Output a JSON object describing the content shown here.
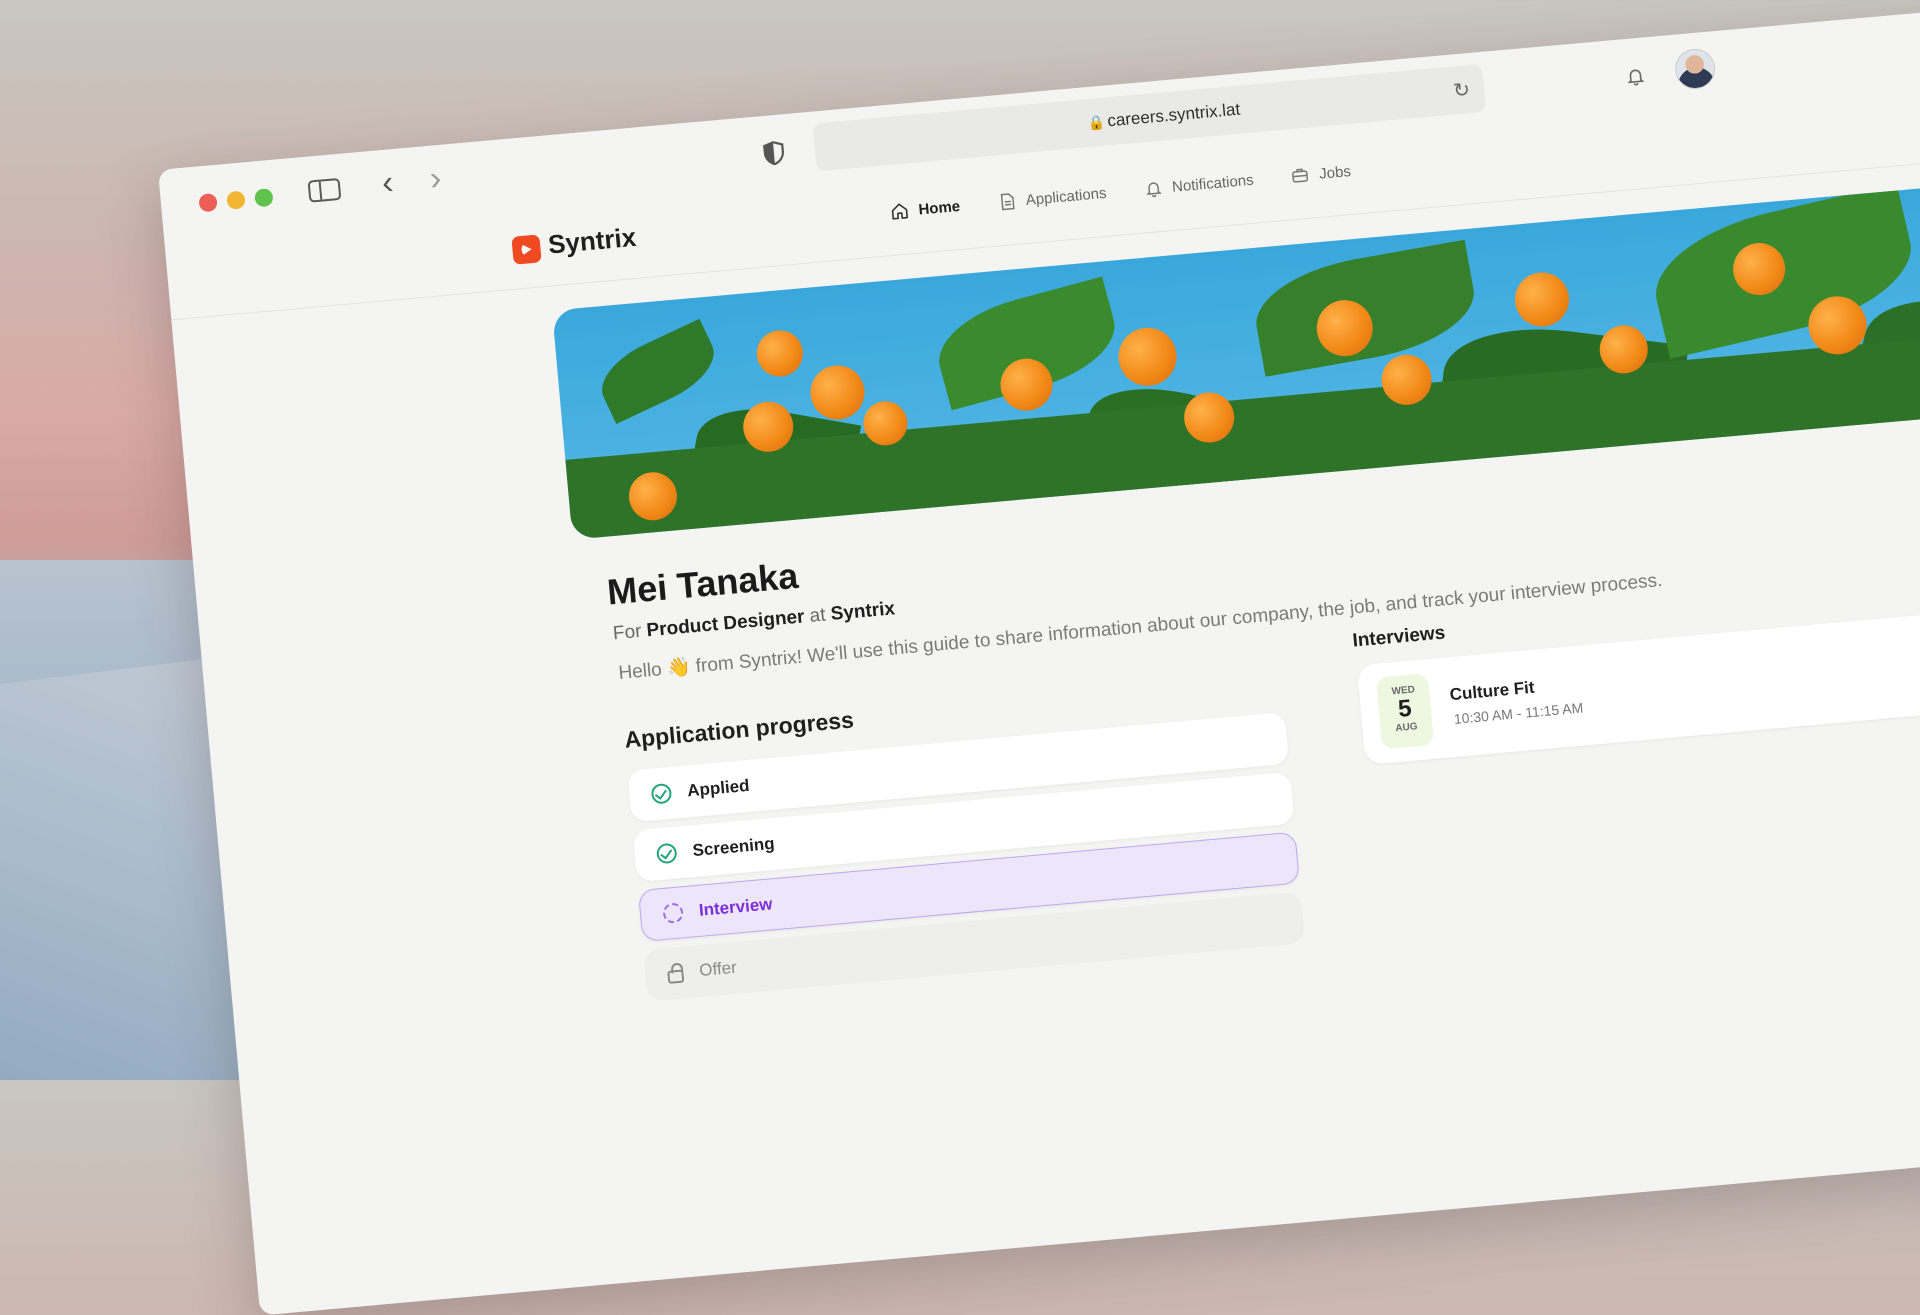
{
  "browser": {
    "url": "careers.syntrix.lat"
  },
  "site": {
    "logo_text": "Syntrix",
    "nav": [
      {
        "label": "Home",
        "icon": "home-icon",
        "active": true
      },
      {
        "label": "Applications",
        "icon": "document-icon",
        "active": false
      },
      {
        "label": "Notifications",
        "icon": "bell-icon",
        "active": false
      },
      {
        "label": "Jobs",
        "icon": "briefcase-icon",
        "active": false
      }
    ]
  },
  "candidate": {
    "name": "Mei Tanaka",
    "role_prefix": "For",
    "role": "Product Designer",
    "at": "at",
    "company": "Syntrix",
    "intro": "Hello 👋 from Syntrix! We'll use this guide to share information about our company, the job, and track your interview process."
  },
  "progress": {
    "title": "Application progress",
    "steps": [
      {
        "label": "Applied",
        "status": "done"
      },
      {
        "label": "Screening",
        "status": "done"
      },
      {
        "label": "Interview",
        "status": "current"
      },
      {
        "label": "Offer",
        "status": "locked"
      }
    ]
  },
  "interviews": {
    "title": "Interviews",
    "items": [
      {
        "dow": "WED",
        "day": "5",
        "month": "AUG",
        "title": "Culture Fit",
        "time": "10:30 AM - 11:15 AM"
      }
    ]
  },
  "colors": {
    "brand": "#f04a23",
    "accent_purple": "#7b2fd8",
    "success_green": "#22a678"
  }
}
